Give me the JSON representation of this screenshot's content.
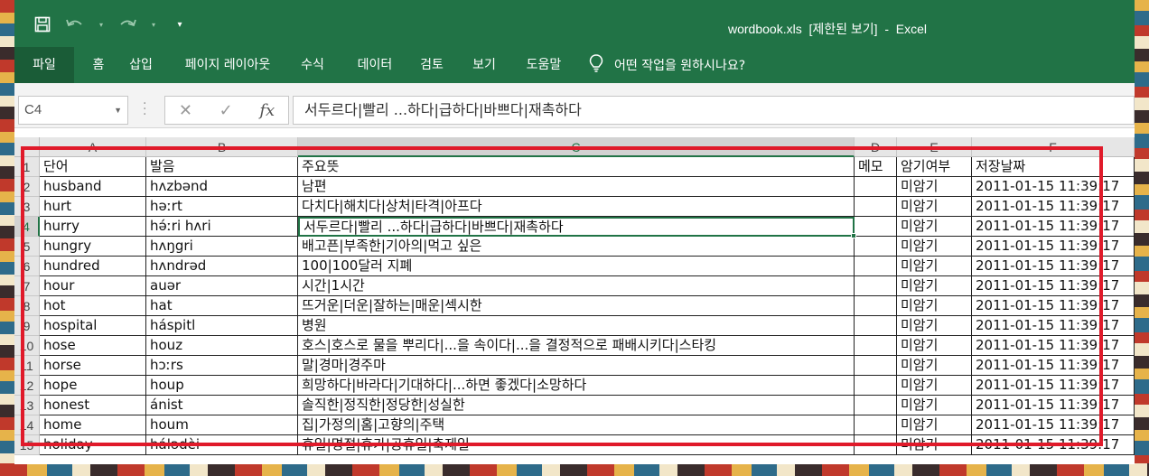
{
  "window": {
    "title": "wordbook.xls  [제한된 보기]  -  Excel"
  },
  "qat": {
    "icons": [
      "save-icon",
      "undo-icon",
      "redo-icon",
      "customize-icon"
    ]
  },
  "ribbon": {
    "tabs": [
      "파일",
      "홈",
      "삽입",
      "페이지 레이아웃",
      "수식",
      "데이터",
      "검토",
      "보기",
      "도움말"
    ],
    "tell_me": "어떤 작업을 원하시나요?"
  },
  "formula_bar": {
    "name_box": "C4",
    "formula": "서두르다|빨리 ...하다|급하다|바쁘다|재촉하다"
  },
  "sheet": {
    "columns": [
      "A",
      "B",
      "C",
      "D",
      "E",
      "F"
    ],
    "selected_column": "C",
    "selected_row": 4,
    "active_cell": "C4",
    "rows": [
      {
        "n": "1",
        "cells": [
          "단어",
          "발음",
          "주요뜻",
          "메모",
          "암기여부",
          "저장날짜"
        ]
      },
      {
        "n": "2",
        "cells": [
          "husband",
          "hʌzbənd",
          "남편",
          "",
          "미암기",
          "2011-01-15 11:39:17"
        ]
      },
      {
        "n": "3",
        "cells": [
          "hurt",
          "həːrt",
          "다치다|해치다|상처|타격|아프다",
          "",
          "미암기",
          "2011-01-15 11:39:17"
        ]
      },
      {
        "n": "4",
        "cells": [
          "hurry",
          "hə́ːri hʌri",
          "서두르다|빨리 ...하다|급하다|바쁘다|재촉하다",
          "",
          "미암기",
          "2011-01-15 11:39:17"
        ]
      },
      {
        "n": "5",
        "cells": [
          "hungry",
          "hʌŋgri",
          "배고픈|부족한|기아의|먹고 싶은",
          "",
          "미암기",
          "2011-01-15 11:39:17"
        ]
      },
      {
        "n": "6",
        "cells": [
          "hundred",
          "hʌndrəd",
          "100|100달러 지폐",
          "",
          "미암기",
          "2011-01-15 11:39:17"
        ]
      },
      {
        "n": "7",
        "cells": [
          "hour",
          "auər",
          "시간|1시간",
          "",
          "미암기",
          "2011-01-15 11:39:17"
        ]
      },
      {
        "n": "8",
        "cells": [
          "hot",
          "hat",
          "뜨거운|더운|잘하는|매운|섹시한",
          "",
          "미암기",
          "2011-01-15 11:39:17"
        ]
      },
      {
        "n": "9",
        "cells": [
          "hospital",
          "háspitl",
          "병원",
          "",
          "미암기",
          "2011-01-15 11:39:17"
        ]
      },
      {
        "n": "10",
        "cells": [
          "hose",
          "houz",
          "호스|호스로 물을 뿌리다|...을 속이다|...을 결정적으로 패배시키다|스타킹",
          "",
          "미암기",
          "2011-01-15 11:39:17"
        ]
      },
      {
        "n": "11",
        "cells": [
          "horse",
          "hɔːrs",
          "말|경마|경주마",
          "",
          "미암기",
          "2011-01-15 11:39:17"
        ]
      },
      {
        "n": "12",
        "cells": [
          "hope",
          "houp",
          "희망하다|바라다|기대하다|...하면 좋겠다|소망하다",
          "",
          "미암기",
          "2011-01-15 11:39:17"
        ]
      },
      {
        "n": "13",
        "cells": [
          "honest",
          "ánist",
          "솔직한|정직한|정당한|성실한",
          "",
          "미암기",
          "2011-01-15 11:39:17"
        ]
      },
      {
        "n": "14",
        "cells": [
          "home",
          "houm",
          "집|가정의|홈|고향의|주택",
          "",
          "미암기",
          "2011-01-15 11:39:17"
        ]
      },
      {
        "n": "15",
        "cells": [
          "holiday",
          "hálədèi",
          "휴일|명절|휴가|공휴일|축제일",
          "",
          "미암기",
          "2011-01-15 11:39:17"
        ]
      }
    ]
  },
  "colors": {
    "excel_green": "#217346",
    "annotation_red": "#e01a2a"
  }
}
